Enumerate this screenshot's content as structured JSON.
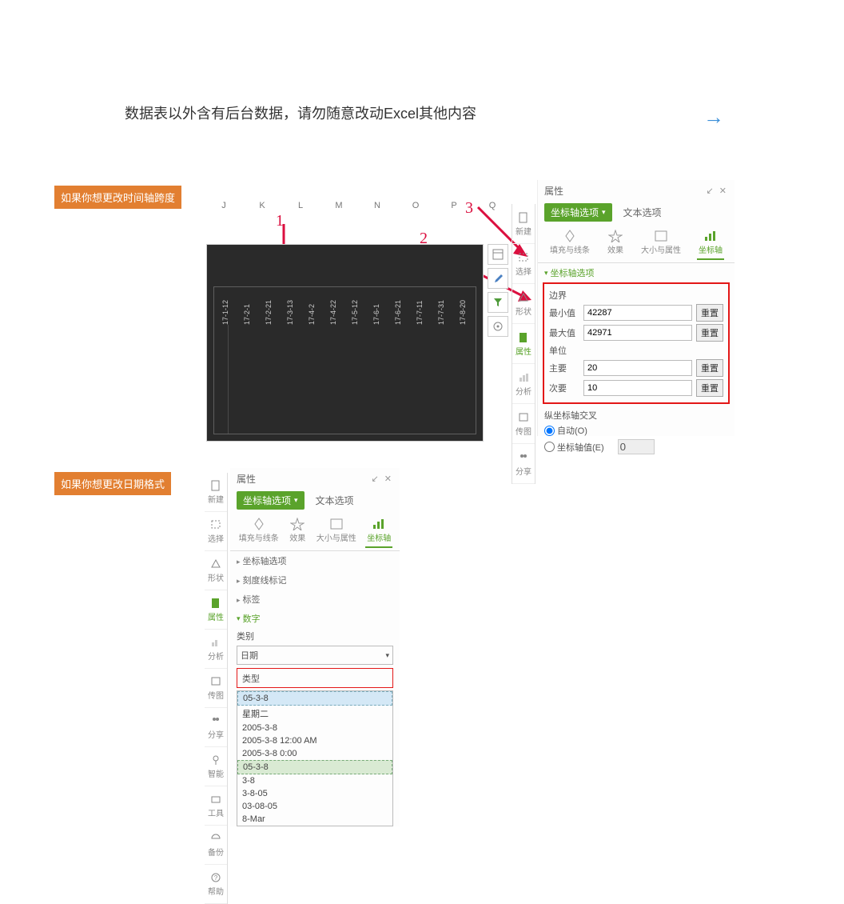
{
  "main_text": "数据表以外含有后台数据，请勿随意改动Excel其他内容",
  "callout1": "如果你想更改时间轴跨度",
  "callout2": "如果你想更改日期格式",
  "arrows": {
    "a1": "1",
    "a2": "2",
    "a3": "3"
  },
  "columns": [
    "J",
    "K",
    "L",
    "M",
    "N",
    "O",
    "P",
    "Q"
  ],
  "chart_dates": [
    "17-1-12",
    "17-2-1",
    "17-2-21",
    "17-3-13",
    "17-4-2",
    "17-4-22",
    "17-5-12",
    "17-6-1",
    "17-6-21",
    "17-7-11",
    "17-7-31",
    "17-8-20"
  ],
  "sidenav": {
    "new": "新建",
    "select": "选择",
    "shape": "形状",
    "props": "属性",
    "analyze": "分析",
    "drawing": "传图",
    "share": "分享",
    "smart": "智能",
    "tools": "工具",
    "backup": "备份",
    "help": "帮助"
  },
  "panel": {
    "title": "属性",
    "dd_axis": "坐标轴选项",
    "tab_text": "文本选项",
    "subtabs": {
      "fill": "填充与线条",
      "effect": "效果",
      "size": "大小与属性",
      "axis": "坐标轴"
    },
    "section_axis_options": "坐标轴选项",
    "bounds": "边界",
    "min": "最小值",
    "min_val": "42287",
    "max": "最大值",
    "max_val": "42971",
    "unit": "单位",
    "major": "主要",
    "major_val": "20",
    "minor": "次要",
    "minor_val": "10",
    "reset": "重置",
    "cross": "纵坐标轴交叉",
    "auto": "自动(O)",
    "axis_value": "坐标轴值(E)",
    "axis_value_val": "0"
  },
  "panel2": {
    "section_axis_options": "坐标轴选项",
    "tick_marks": "刻度线标记",
    "labels": "标签",
    "number": "数字",
    "category": "类别",
    "category_val": "日期",
    "type": "类型",
    "options": [
      "05-3-8",
      "星期二",
      "2005-3-8",
      "2005-3-8 12:00 AM",
      "2005-3-8 0:00",
      "05-3-8",
      "3-8",
      "3-8-05",
      "03-08-05",
      "8-Mar"
    ]
  }
}
